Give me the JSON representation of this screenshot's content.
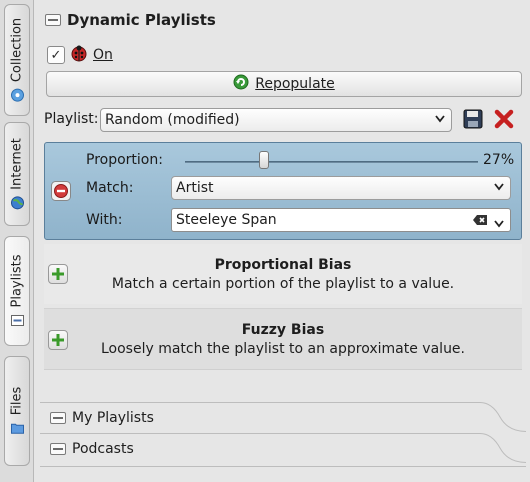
{
  "side_tabs": [
    {
      "label": "Collection",
      "icon": "collection-disc-icon",
      "active": false
    },
    {
      "label": "Internet",
      "icon": "globe-icon",
      "active": false
    },
    {
      "label": "Playlists",
      "icon": "playlist-icon",
      "active": true
    },
    {
      "label": "Files",
      "icon": "folder-icon",
      "active": false
    }
  ],
  "header": {
    "title": "Dynamic Playlists"
  },
  "toggle": {
    "label": "On",
    "checked": true
  },
  "repopulate": {
    "label": "Repopulate"
  },
  "playlist_row": {
    "label": "Playlist:",
    "value": "Random (modified)"
  },
  "bias_editor": {
    "proportion_label": "Proportion:",
    "proportion_value": "27%",
    "proportion_fraction": 0.27,
    "match_label": "Match:",
    "match_value": "Artist",
    "with_label": "With:",
    "with_value": "Steeleye Span"
  },
  "biases": [
    {
      "title": "Proportional Bias",
      "description": "Match a certain portion of the playlist to a value."
    },
    {
      "title": "Fuzzy Bias",
      "description": "Loosely match the playlist to an approximate value."
    }
  ],
  "collapsed": [
    {
      "label": "My Playlists"
    },
    {
      "label": "Podcasts"
    }
  ],
  "colors": {
    "accent_blue": "#8fb3cb",
    "remove_red": "#d23b3b",
    "add_green": "#3a9a2a"
  }
}
